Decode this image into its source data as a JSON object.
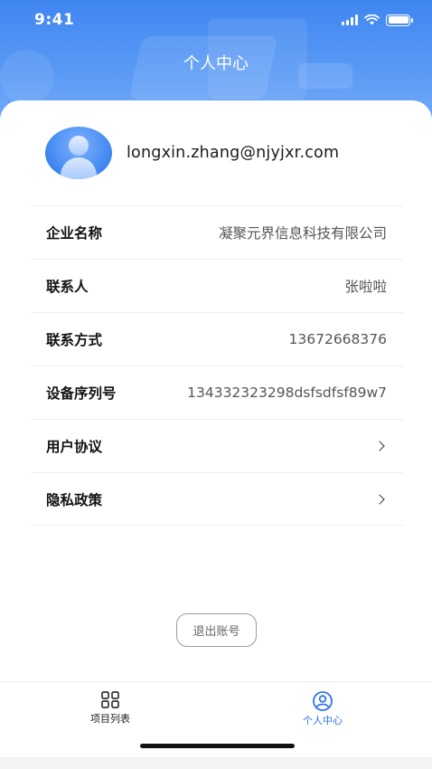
{
  "status_bar": {
    "time": "9:41"
  },
  "header": {
    "title": "个人中心"
  },
  "profile": {
    "email": "longxin.zhang@njyjxr.com",
    "avatar_icon": "user-avatar-icon"
  },
  "rows": [
    {
      "label": "企业名称",
      "value": "凝聚元界信息科技有限公司"
    },
    {
      "label": "联系人",
      "value": "张啦啦"
    },
    {
      "label": "联系方式",
      "value": "13672668376"
    },
    {
      "label": "设备序列号",
      "value": "134332323298dsfsdfsf89w7"
    },
    {
      "label": "用户协议",
      "icon": "chevron-right-icon"
    },
    {
      "label": "隐私政策",
      "icon": "chevron-right-icon"
    }
  ],
  "logout": {
    "label": "退出账号"
  },
  "tabbar": {
    "tabs": [
      {
        "label": "项目列表",
        "icon": "grid-icon",
        "active": false
      },
      {
        "label": "个人中心",
        "icon": "profile-icon",
        "active": true
      }
    ],
    "active_color": "#2f74e8"
  },
  "colors": {
    "header_blue": "#3f86f0"
  }
}
